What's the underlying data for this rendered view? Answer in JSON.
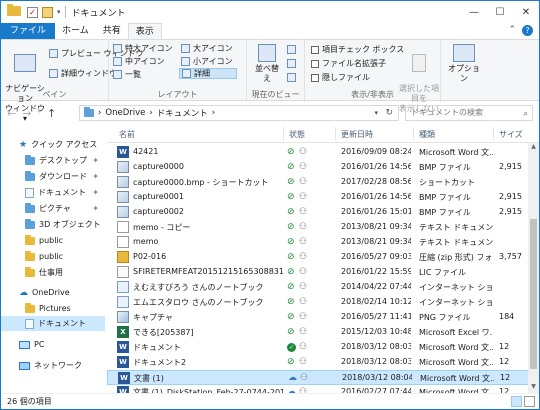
{
  "window": {
    "title": "ドキュメント",
    "controls": {
      "minimize": "—",
      "maximize": "☐",
      "close": "✕"
    }
  },
  "ribbon_tabs": [
    "ファイル",
    "ホーム",
    "共有",
    "表示"
  ],
  "ribbon": {
    "pane": {
      "nav_pane": "ナビゲーション\nウィンドウ▾",
      "preview": "プレビュー ウィンドウ",
      "details": "詳細ウィンドウ",
      "label": "ペイン"
    },
    "layout": {
      "xl_icons": "特大アイコン",
      "l_icons": "大アイコン",
      "m_icons": "中アイコン",
      "s_icons": "小アイコン",
      "list": "一覧",
      "details": "詳細",
      "label": "レイアウト"
    },
    "current_view": {
      "sort": "並べ替え",
      "label": "現在のビュー"
    },
    "show_hide": {
      "item_checkbox": "項目チェック ボックス",
      "file_ext": "ファイル名拡張子",
      "hidden": "隠しファイル",
      "hide_selected": "選択した項目を\n表示しない",
      "label": "表示/非表示"
    },
    "options": "オプション"
  },
  "address": {
    "crumb1": "OneDrive",
    "crumb2": "ドキュメント",
    "sep": "›"
  },
  "search": {
    "placeholder": "ドキュメントの検索"
  },
  "nav_pane": {
    "quick_access": "クイック アクセス",
    "items": [
      "デスクトップ",
      "ダウンロード",
      "ドキュメント",
      "ピクチャ",
      "3D オブジェクト",
      "public",
      "public",
      "仕事用"
    ],
    "onedrive": "OneDrive",
    "onedrive_children": [
      "Pictures",
      "ドキュメント"
    ],
    "pc": "PC",
    "network": "ネットワーク"
  },
  "columns": {
    "name": "名前",
    "status": "状態",
    "date": "更新日時",
    "type": "種類",
    "size": "サイズ"
  },
  "files": [
    {
      "name": "42421",
      "status": "ok",
      "date": "2016/09/09 08:24",
      "type": "Microsoft Word 文...",
      "size": "",
      "icon": "word"
    },
    {
      "name": "capture0000",
      "status": "ok",
      "date": "2016/01/26 14:56",
      "type": "BMP ファイル",
      "size": "2,915",
      "icon": "bmp"
    },
    {
      "name": "capture0000.bmp - ショートカット",
      "status": "ok",
      "date": "2017/02/28 08:56",
      "type": "ショートカット",
      "size": "",
      "icon": "bmp"
    },
    {
      "name": "capture0001",
      "status": "ok",
      "date": "2016/01/26 14:56",
      "type": "BMP ファイル",
      "size": "2,915",
      "icon": "bmp"
    },
    {
      "name": "capture0002",
      "status": "ok",
      "date": "2016/01/26 15:01",
      "type": "BMP ファイル",
      "size": "2,915",
      "icon": "bmp"
    },
    {
      "name": "memo - コピー",
      "status": "ok",
      "date": "2013/08/21 09:34",
      "type": "テキスト ドキュメント",
      "size": "",
      "icon": "txt"
    },
    {
      "name": "memo",
      "status": "ok",
      "date": "2013/08/21 09:34",
      "type": "テキスト ドキュメント",
      "size": "",
      "icon": "txt"
    },
    {
      "name": "P02-016",
      "status": "ok",
      "date": "2016/05/27 09:03",
      "type": "圧縮 (zip 形式) フォ...",
      "size": "3,757",
      "icon": "zip"
    },
    {
      "name": "SFIRETERMFEAT201512151653088310.lic",
      "status": "ok",
      "date": "2016/01/22 15:59",
      "type": "LIC ファイル",
      "size": "",
      "icon": "lic"
    },
    {
      "name": "えむえすびろう さんのノートブック",
      "status": "ok",
      "date": "2014/04/22 07:44",
      "type": "インターネット ショート...",
      "size": "",
      "icon": "url"
    },
    {
      "name": "エムエスタロウ さんのノートブック",
      "status": "ok",
      "date": "2018/02/14 10:12",
      "type": "インターネット ショート...",
      "size": "",
      "icon": "url"
    },
    {
      "name": "キャプチャ",
      "status": "ok",
      "date": "2016/05/27 11:41",
      "type": "PNG ファイル",
      "size": "184",
      "icon": "png"
    },
    {
      "name": "できる[205387]",
      "status": "ok",
      "date": "2015/12/03 10:48",
      "type": "Microsoft Excel ワ...",
      "size": "",
      "icon": "excel"
    },
    {
      "name": "ドキュメント",
      "status": "full",
      "date": "2018/03/12 08:03",
      "type": "Microsoft Word 文...",
      "size": "12",
      "icon": "word"
    },
    {
      "name": "ドキュメント2",
      "status": "ok",
      "date": "2018/03/12 08:03",
      "type": "Microsoft Word 文...",
      "size": "12",
      "icon": "word"
    },
    {
      "name": "文書 (1)",
      "status": "cloud",
      "date": "2018/03/12 08:04",
      "type": "Microsoft Word 文...",
      "size": "12",
      "icon": "word",
      "selected": true
    },
    {
      "name": "文書 (1)_DiskStation_Feb-27-0744-2016_...",
      "status": "cloud",
      "date": "2016/02/27 07:44",
      "type": "Microsoft Word 文...",
      "size": "12",
      "icon": "word"
    }
  ],
  "status_bar": {
    "count": "26 個の項目"
  }
}
